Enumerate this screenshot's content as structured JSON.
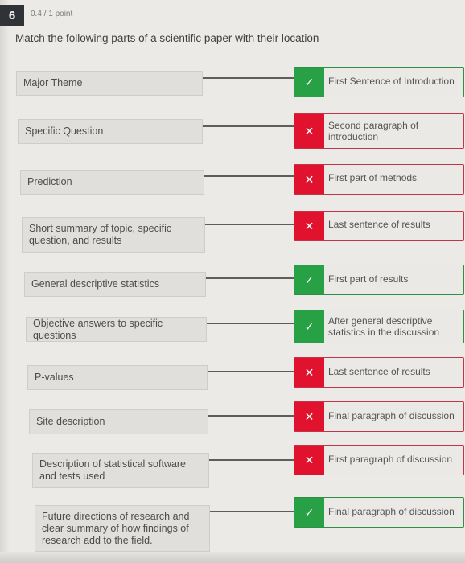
{
  "question": {
    "number": "6",
    "points": "0.4 / 1 point",
    "prompt": "Match the following parts of a scientific paper with their location"
  },
  "colors": {
    "correct": "#27a046",
    "wrong": "#e0122e"
  },
  "pairs": [
    {
      "term": "Major Theme",
      "answer": "First Sentence of Introduction",
      "status": "correct",
      "status_icon": "✓"
    },
    {
      "term": "Specific Question",
      "answer": "Second paragraph of introduction",
      "status": "wrong",
      "status_icon": "✕"
    },
    {
      "term": "Prediction",
      "answer": "First part of methods",
      "status": "wrong",
      "status_icon": "✕"
    },
    {
      "term": "Short summary of topic, specific question, and results",
      "answer": "Last sentence of results",
      "status": "wrong",
      "status_icon": "✕"
    },
    {
      "term": "General descriptive statistics",
      "answer": "First part of results",
      "status": "correct",
      "status_icon": "✓"
    },
    {
      "term": "Objective answers to specific questions",
      "answer": "After general descriptive statistics in the discussion",
      "status": "correct",
      "status_icon": "✓"
    },
    {
      "term": "P-values",
      "answer": "Last sentence of results",
      "status": "wrong",
      "status_icon": "✕"
    },
    {
      "term": "Site description",
      "answer": "Final paragraph of discussion",
      "status": "wrong",
      "status_icon": "✕"
    },
    {
      "term": "Description of statistical software and tests used",
      "answer": "First paragraph of discussion",
      "status": "wrong",
      "status_icon": "✕"
    },
    {
      "term": "Future directions of research and clear summary of how findings of research add to the field.",
      "answer": "Final paragraph of discussion",
      "status": "correct",
      "status_icon": "✓"
    }
  ]
}
